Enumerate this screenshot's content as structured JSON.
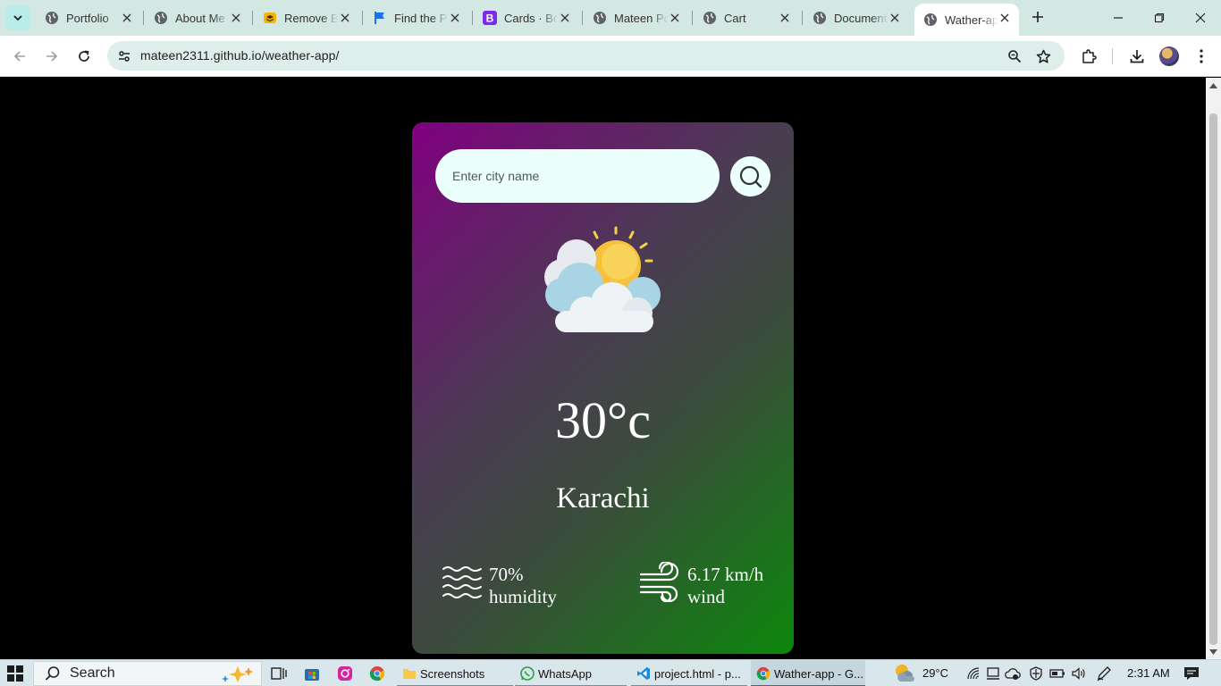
{
  "browser": {
    "tabs": [
      {
        "title": "Portfolio",
        "icon": "globe-icon"
      },
      {
        "title": "About Me",
        "icon": "globe-icon"
      },
      {
        "title": "Remove Background",
        "icon": "stack-icon"
      },
      {
        "title": "Find the Perfect",
        "icon": "flag-icon"
      },
      {
        "title": "Cards · Bootstrap",
        "icon": "bootstrap-icon"
      },
      {
        "title": "Mateen Portfolio",
        "icon": "globe-icon"
      },
      {
        "title": "Cart",
        "icon": "globe-icon"
      },
      {
        "title": "Document",
        "icon": "globe-icon"
      },
      {
        "title": "Wather-app",
        "icon": "globe-icon",
        "active": true
      }
    ],
    "url": "mateen2311.github.io/weather-app/"
  },
  "weather": {
    "search_placeholder": "Enter city name",
    "temperature": "30°c",
    "city": "Karachi",
    "humidity_value": "70%",
    "humidity_label": "humidity",
    "wind_value": "6.17 km/h",
    "wind_label": "wind",
    "gradient_start": "#800080",
    "gradient_end": "#0c870c"
  },
  "taskbar": {
    "search_label": "Search",
    "apps": [
      {
        "label": "Screenshots",
        "icon": "folder-icon"
      },
      {
        "label": "WhatsApp",
        "icon": "whatsapp-icon"
      },
      {
        "label": "project.html - p...",
        "icon": "vscode-icon"
      },
      {
        "label": "Wather-app - G...",
        "icon": "chrome-icon",
        "active": true
      }
    ],
    "weather_temp": "29°C",
    "time": "2:31 AM"
  }
}
